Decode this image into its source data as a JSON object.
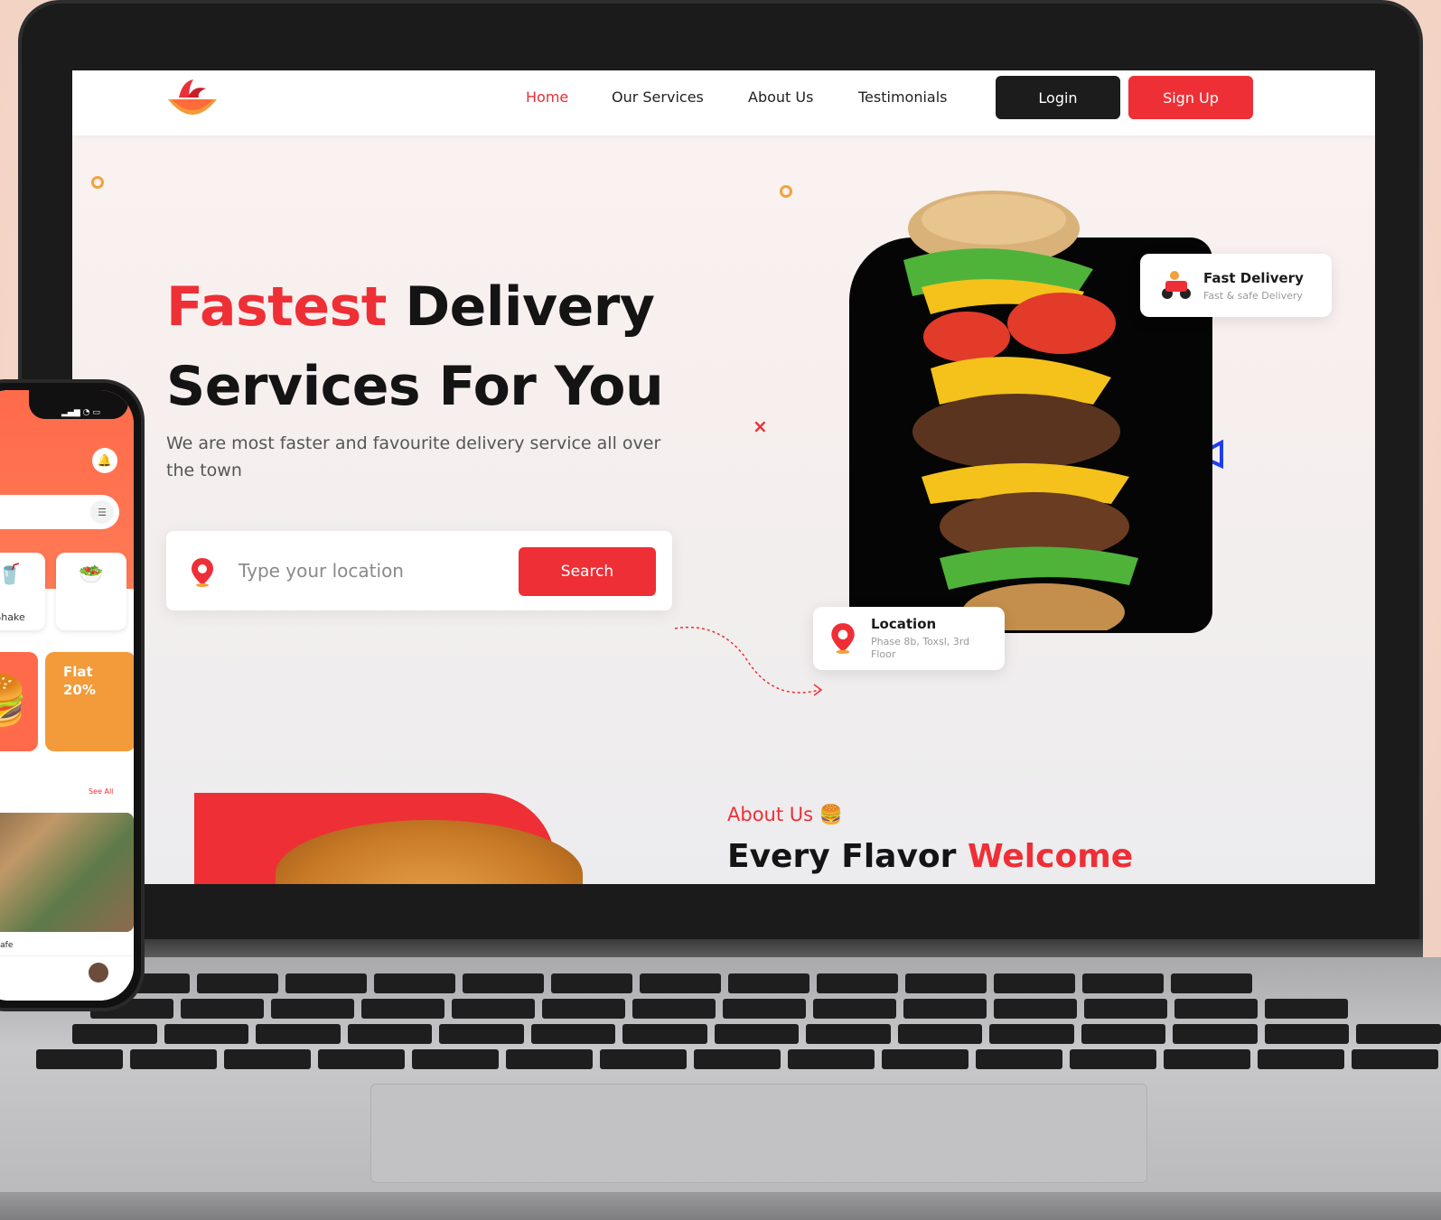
{
  "nav": {
    "links": [
      "Home",
      "Our Services",
      "About Us",
      "Testimonials"
    ],
    "login_label": "Login",
    "signup_label": "Sign Up"
  },
  "hero": {
    "title_highlight": "Fastest",
    "title_rest_line1": "Delivery",
    "title_line2": "Services For You",
    "subtitle": "We are most faster and favourite delivery service all over the town",
    "search_placeholder": "Type your location",
    "search_button": "Search"
  },
  "badges": {
    "fast_delivery_title": "Fast Delivery",
    "fast_delivery_sub": "Fast & safe Delivery",
    "location_title": "Location",
    "location_sub": "Phase 8b, Toxsl, 3rd Floor"
  },
  "about": {
    "label": "About Us",
    "heading_black": "Every Flavor",
    "heading_red": "Welcome"
  },
  "phone": {
    "category_label": "Shake",
    "promo_line1": "Flat",
    "promo_line2": "20%",
    "see_all": "See All",
    "cafe_name": "Havun Cafe"
  },
  "colors": {
    "accent": "#ee2f36",
    "dark": "#1c1c1c",
    "ring": "#f2a23a"
  }
}
